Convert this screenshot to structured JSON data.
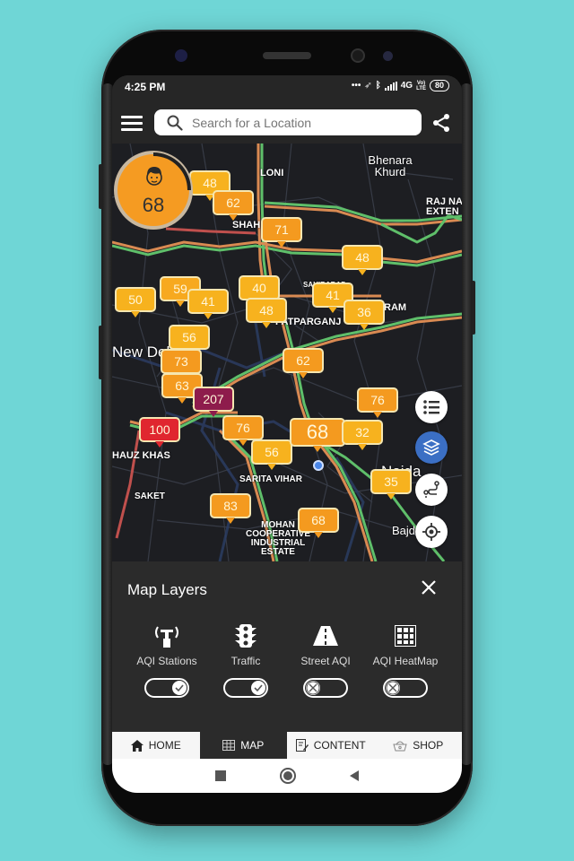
{
  "status_bar": {
    "time": "4:25 PM",
    "network": "4G",
    "volte": "VoLTE",
    "battery": "80"
  },
  "top_bar": {
    "search_placeholder": "Search for a Location"
  },
  "aqi_badge": {
    "value": "68",
    "color": "#f59b22"
  },
  "map": {
    "places": [
      {
        "name": "LONI"
      },
      {
        "name": "Bhenara Khurd"
      },
      {
        "name": "RAJ NA EXTEN"
      },
      {
        "name": "SHAH"
      },
      {
        "name": "SAHIBABAD"
      },
      {
        "name": "RAM"
      },
      {
        "name": "PATPARGANJ"
      },
      {
        "name": "New Delhi"
      },
      {
        "name": "HAUZ KHAS"
      },
      {
        "name": "SARITA VIHAR"
      },
      {
        "name": "SAKET"
      },
      {
        "name": "Noida"
      },
      {
        "name": "MOHAN COOPERATIVE INDUSTRIAL ESTATE"
      },
      {
        "name": "Bajd"
      }
    ],
    "markers": [
      {
        "value": "48",
        "color": "#f7b21e"
      },
      {
        "value": "62",
        "color": "#f49a1f"
      },
      {
        "value": "71",
        "color": "#f49a1f"
      },
      {
        "value": "48",
        "color": "#f7b21e"
      },
      {
        "value": "50",
        "color": "#f7b21e"
      },
      {
        "value": "59",
        "color": "#f7a91f"
      },
      {
        "value": "41",
        "color": "#f7b21e"
      },
      {
        "value": "40",
        "color": "#f7b21e"
      },
      {
        "value": "48",
        "color": "#f7b21e"
      },
      {
        "value": "41",
        "color": "#f7b21e"
      },
      {
        "value": "36",
        "color": "#f7b21e"
      },
      {
        "value": "56",
        "color": "#f7b21e"
      },
      {
        "value": "73",
        "color": "#f49a1f"
      },
      {
        "value": "63",
        "color": "#f49a1f"
      },
      {
        "value": "62",
        "color": "#f49a1f"
      },
      {
        "value": "207",
        "color": "#8e1c4c"
      },
      {
        "value": "76",
        "color": "#f49a1f"
      },
      {
        "value": "100",
        "color": "#e0262f"
      },
      {
        "value": "76",
        "color": "#f49a1f"
      },
      {
        "value": "56",
        "color": "#f7b21e"
      },
      {
        "value": "68",
        "color": "#f49a1f"
      },
      {
        "value": "32",
        "color": "#f7b21e"
      },
      {
        "value": "35",
        "color": "#f7b21e"
      },
      {
        "value": "83",
        "color": "#f49a1f"
      },
      {
        "value": "68",
        "color": "#f49a1f"
      }
    ],
    "fabs": [
      {
        "icon": "list-icon"
      },
      {
        "icon": "layers-icon",
        "active": true
      },
      {
        "icon": "route-icon"
      },
      {
        "icon": "my-location-icon"
      }
    ]
  },
  "map_layers": {
    "title": "Map Layers",
    "items": [
      {
        "label": "AQI Stations",
        "icon": "antenna-icon",
        "enabled": true
      },
      {
        "label": "Traffic",
        "icon": "traffic-light-icon",
        "enabled": true
      },
      {
        "label": "Street AQI",
        "icon": "road-icon",
        "enabled": false
      },
      {
        "label": "AQI HeatMap",
        "icon": "grid-icon",
        "enabled": false
      }
    ]
  },
  "tabs": [
    {
      "label": "HOME",
      "icon": "home-icon",
      "active": false
    },
    {
      "label": "MAP",
      "icon": "map-icon",
      "active": true
    },
    {
      "label": "CONTENT",
      "icon": "content-icon",
      "active": false
    },
    {
      "label": "SHOP",
      "icon": "basket-icon",
      "active": false
    }
  ]
}
